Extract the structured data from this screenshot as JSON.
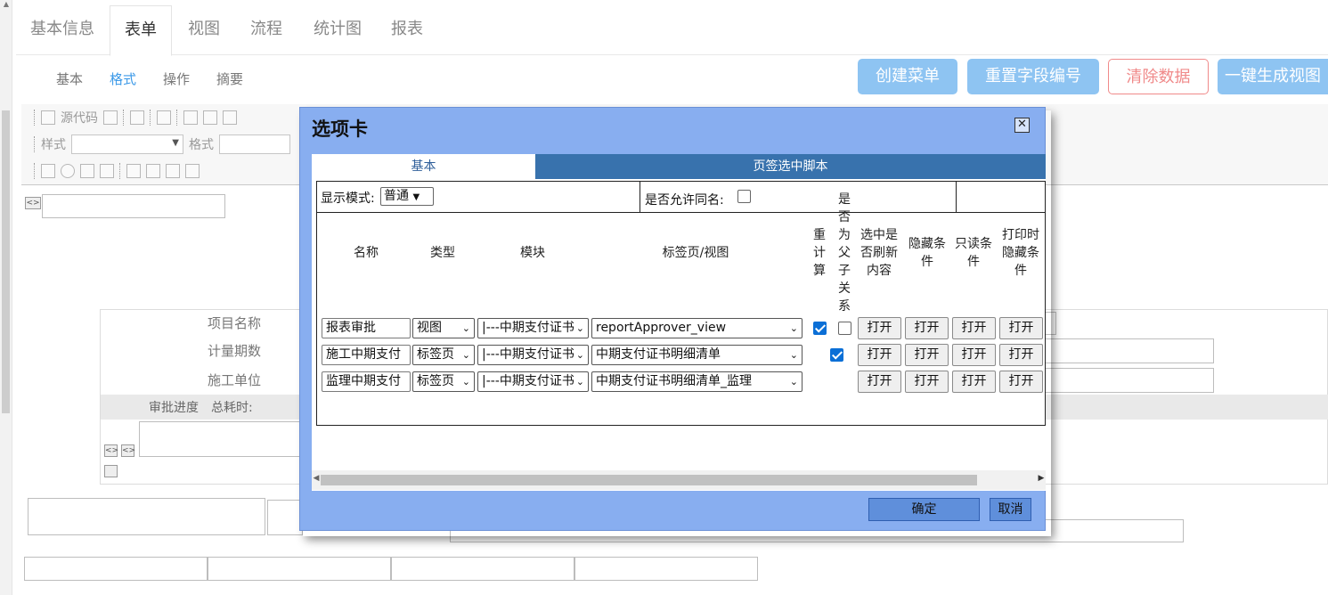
{
  "top_tabs": [
    "基本信息",
    "表单",
    "视图",
    "流程",
    "统计图",
    "报表"
  ],
  "sub_tabs": [
    "基本",
    "格式",
    "操作",
    "摘要"
  ],
  "actions": {
    "create_menu": "创建菜单",
    "reset_field_no": "重置字段编号",
    "clear_data": "清除数据",
    "generate_view": "一键生成视图"
  },
  "toolbar": {
    "source_code": "源代码",
    "style_label": "样式",
    "format_label": "格式"
  },
  "form_rows": {
    "project_name": "项目名称",
    "period_count": "计量期数",
    "construction_unit": "施工单位",
    "progress": "审批进度",
    "total_time": "总耗时:"
  },
  "dialog": {
    "title": "选项卡",
    "tabs": {
      "basic": "基本",
      "script": "页签选中脚本"
    },
    "display_mode_label": "显示模式:",
    "display_mode_value": "普通",
    "allow_same_name_label": "是否允许同名:",
    "columns": {
      "name": "名称",
      "type": "类型",
      "module": "模块",
      "tab_view": "标签页/视图",
      "recalc": "重计算",
      "is_parent": "是否为父子关系",
      "refresh_on_select": "选中是否刷新内容",
      "hide_cond": "隐藏条件",
      "readonly_cond": "只读条件",
      "print_hide_cond": "打印时隐藏条件"
    },
    "rows": [
      {
        "name": "报表审批",
        "type": "视图",
        "module": "|---中期支付证书",
        "view": "reportApprover_view",
        "recalc": true,
        "is_parent": false
      },
      {
        "name": "施工中期支付",
        "type": "标签页",
        "module": "|---中期支付证书",
        "view": "中期支付证书明细清单",
        "recalc": true,
        "is_parent": true
      },
      {
        "name": "监理中期支付",
        "type": "标签页",
        "module": "|---中期支付证书",
        "view": "中期支付证书明细清单_监理",
        "recalc": true,
        "is_parent": true
      }
    ],
    "open_label": "打开",
    "ok": "确定",
    "cancel": "取消"
  }
}
